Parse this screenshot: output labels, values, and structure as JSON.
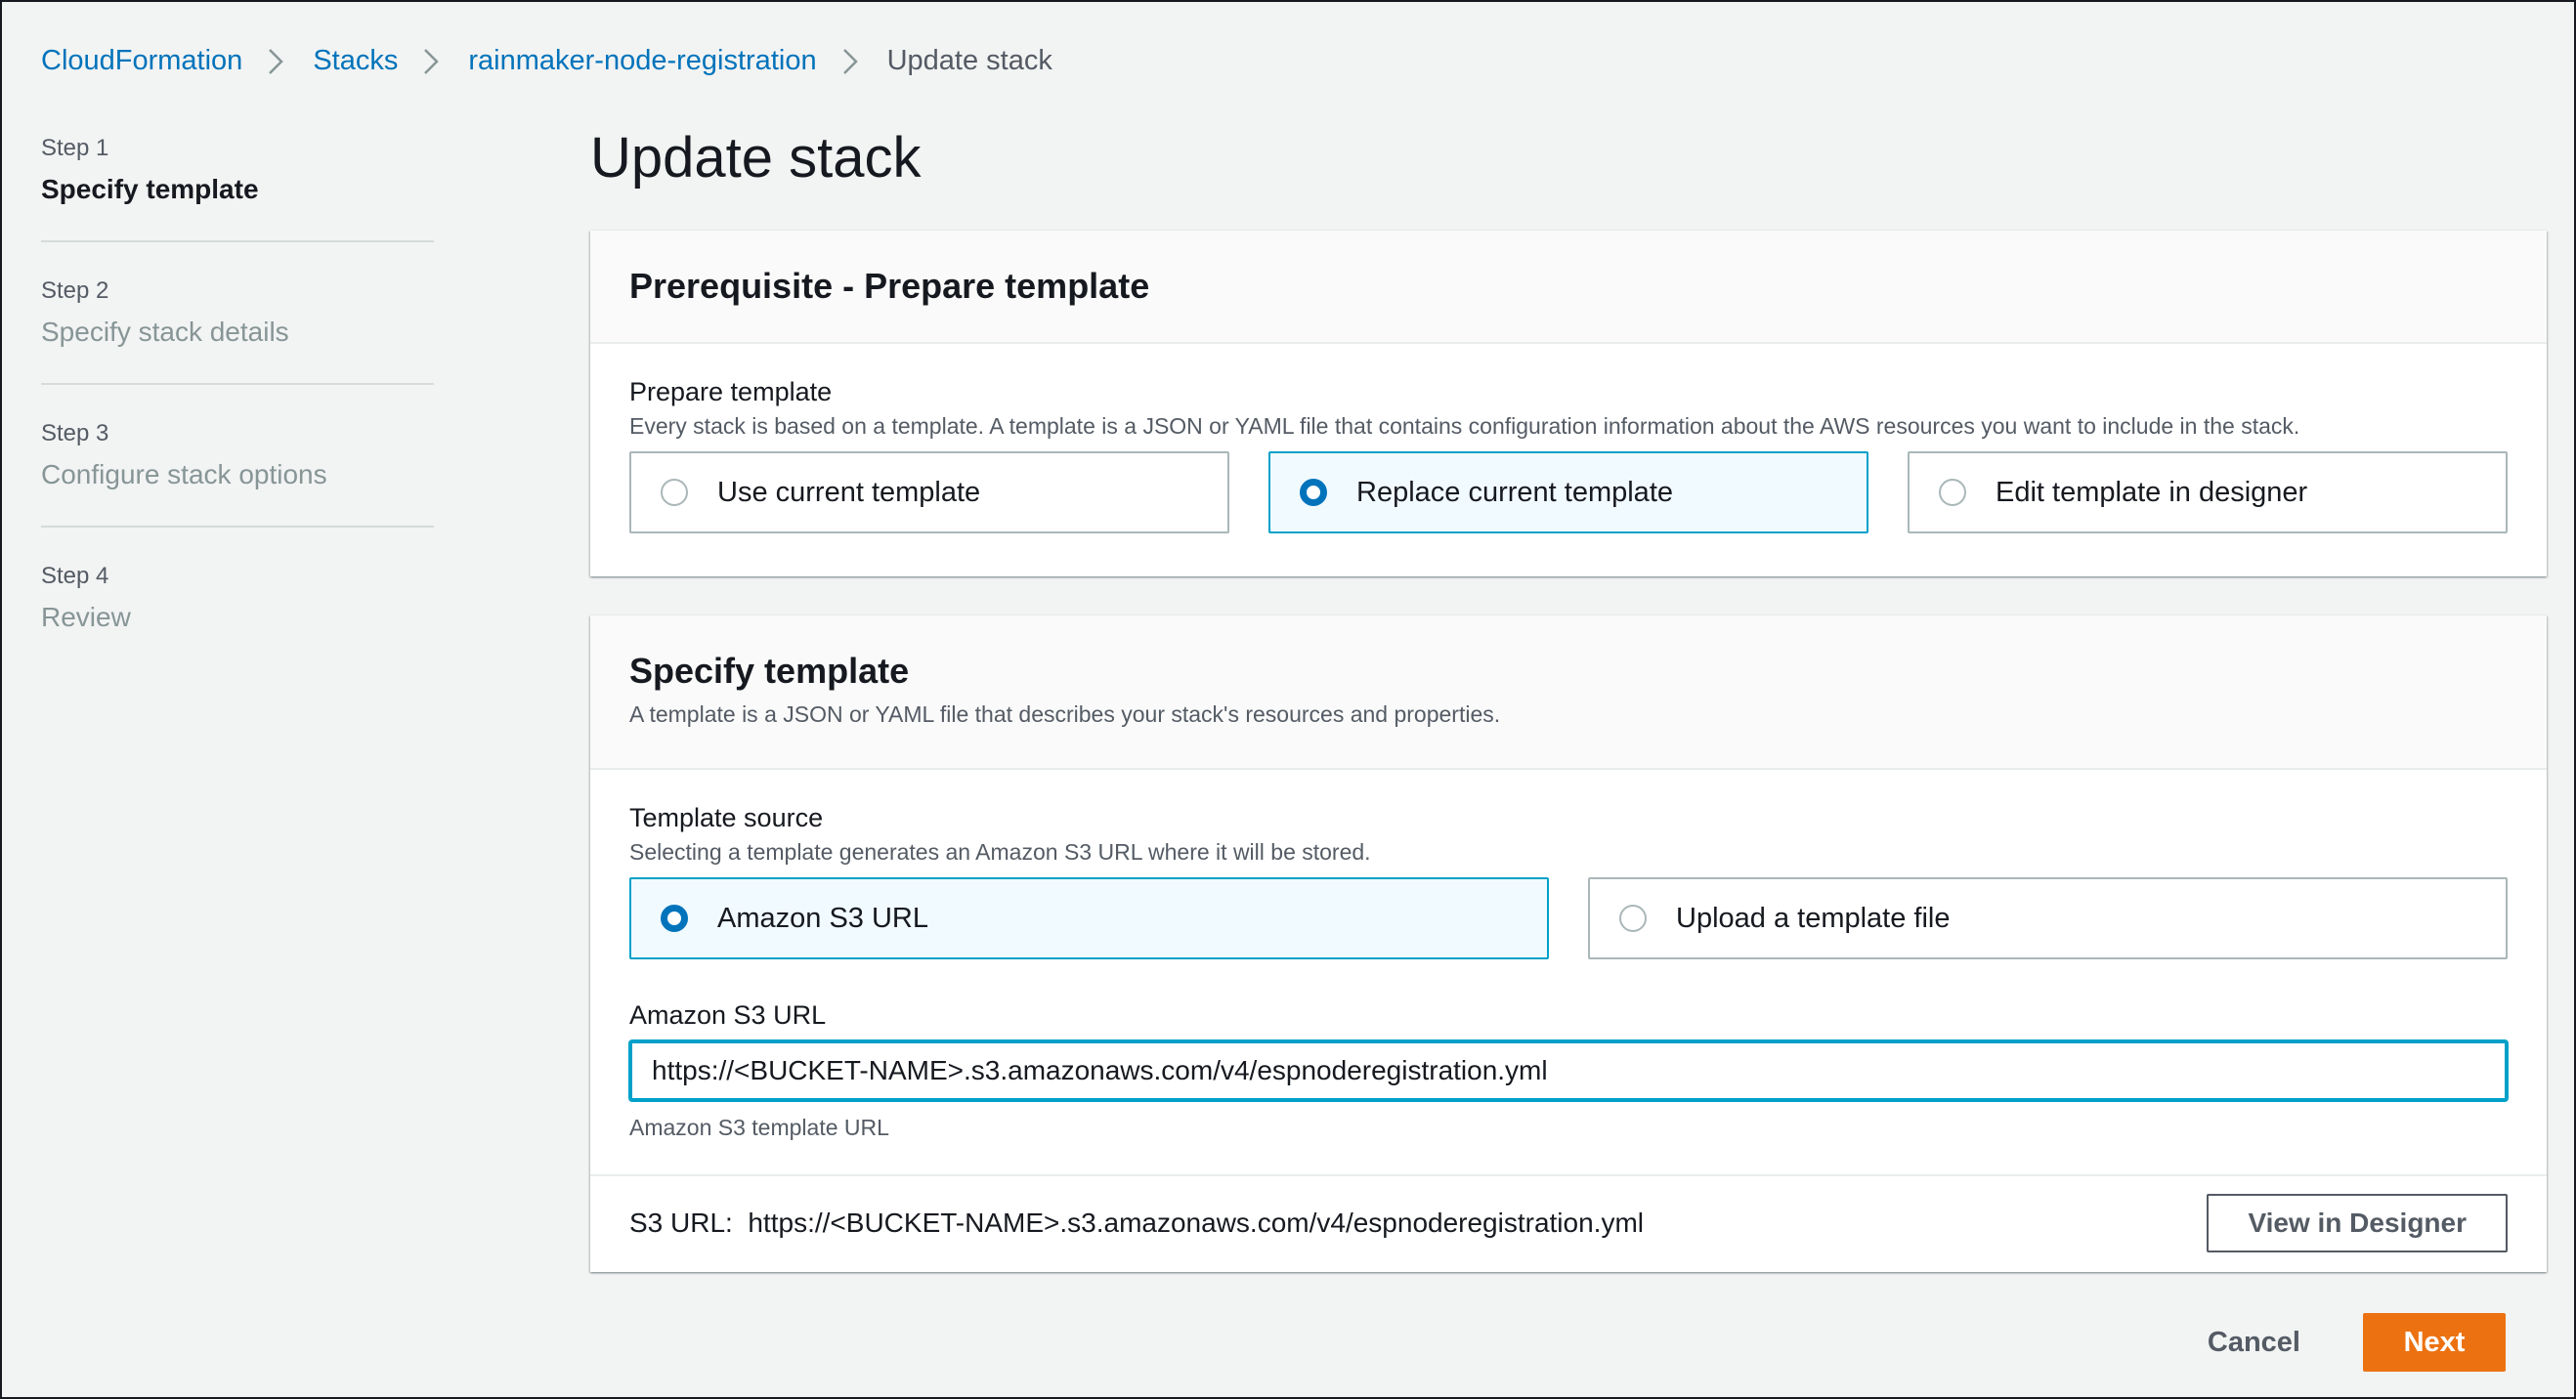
{
  "breadcrumb": {
    "items": [
      "CloudFormation",
      "Stacks",
      "rainmaker-node-registration"
    ],
    "current": "Update stack"
  },
  "steps": [
    {
      "num": "Step 1",
      "title": "Specify template",
      "active": true
    },
    {
      "num": "Step 2",
      "title": "Specify stack details",
      "active": false
    },
    {
      "num": "Step 3",
      "title": "Configure stack options",
      "active": false
    },
    {
      "num": "Step 4",
      "title": "Review",
      "active": false
    }
  ],
  "page_title": "Update stack",
  "prerequisite": {
    "title": "Prerequisite - Prepare template",
    "field_label": "Prepare template",
    "field_desc": "Every stack is based on a template. A template is a JSON or YAML file that contains configuration information about the AWS resources you want to include in the stack.",
    "options": [
      "Use current template",
      "Replace current template",
      "Edit template in designer"
    ],
    "selected_option": "Replace current template"
  },
  "specify": {
    "title": "Specify template",
    "desc": "A template is a JSON or YAML file that describes your stack's resources and properties.",
    "source_label": "Template source",
    "source_desc": "Selecting a template generates an Amazon S3 URL where it will be stored.",
    "sources": [
      "Amazon S3 URL",
      "Upload a template file"
    ],
    "selected_source": "Amazon S3 URL",
    "url_label": "Amazon S3 URL",
    "url_value": "https://<BUCKET-NAME>.s3.amazonaws.com/v4/espnoderegistration.yml",
    "url_constraint": "Amazon S3 template URL",
    "s3_url_label": "S3 URL:",
    "s3_url_value": "https://<BUCKET-NAME>.s3.amazonaws.com/v4/espnoderegistration.yml",
    "view_designer_label": "View in Designer"
  },
  "actions": {
    "cancel_label": "Cancel",
    "next_label": "Next"
  },
  "colors": {
    "link": "#0073bb",
    "primary": "#ec7211",
    "focus": "#00a1c9",
    "selected_bg": "#f1faff"
  }
}
